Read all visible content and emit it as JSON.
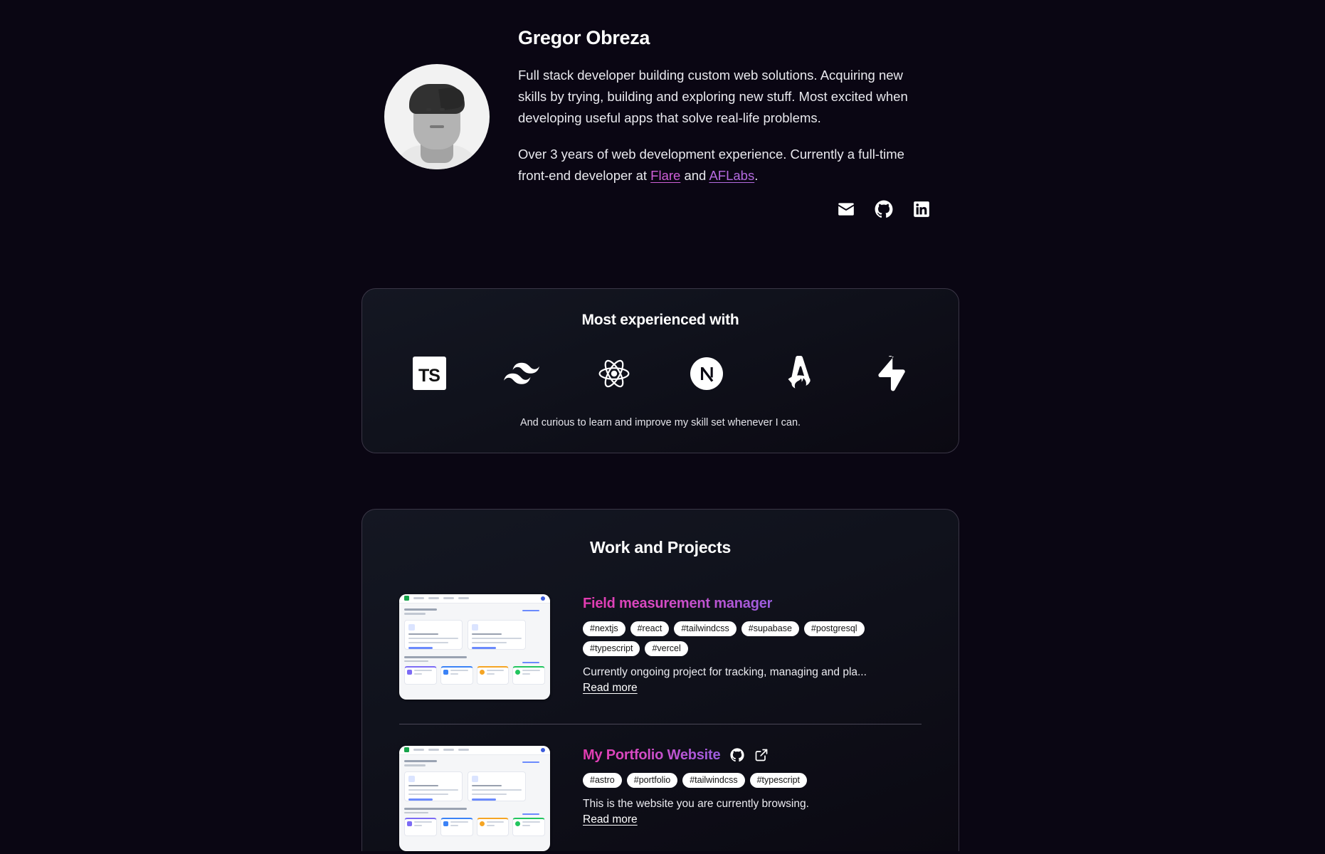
{
  "hero": {
    "name": "Gregor Obreza",
    "avatar_alt": "portrait-photo",
    "paragraph1": "Full stack developer building custom web solutions. Acquiring new skills by trying, building and exploring new stuff. Most excited when developing useful apps that solve real-life problems.",
    "paragraph2_before": "Over 3 years of web development experience. Currently a full-time front-end developer at ",
    "link_flare": "Flare",
    "paragraph2_middle": " and ",
    "link_aflabs": "AFLabs",
    "paragraph2_after": ".",
    "socials": [
      {
        "name": "email-icon",
        "label": "Email"
      },
      {
        "name": "github-icon",
        "label": "GitHub"
      },
      {
        "name": "linkedin-icon",
        "label": "LinkedIn"
      }
    ]
  },
  "skills": {
    "title": "Most experienced with",
    "note": "And curious to learn and improve my skill set whenever I can.",
    "items": [
      {
        "icon": "typescript-icon",
        "label": "TypeScript",
        "glyph": "TS"
      },
      {
        "icon": "tailwindcss-icon",
        "label": "Tailwind CSS"
      },
      {
        "icon": "react-icon",
        "label": "React"
      },
      {
        "icon": "nextjs-icon",
        "label": "Next.js"
      },
      {
        "icon": "astro-icon",
        "label": "Astro"
      },
      {
        "icon": "supabase-icon",
        "label": "Supabase"
      }
    ]
  },
  "projects": {
    "title": "Work and Projects",
    "read_more_label": "Read more",
    "items": [
      {
        "title": "Field measurement manager",
        "thumbnail": "dashboard-screenshot",
        "tags": [
          "#nextjs",
          "#react",
          "#tailwindcss",
          "#supabase",
          "#postgresql",
          "#typescript",
          "#vercel"
        ],
        "description": "Currently ongoing project for tracking, managing and pla...",
        "links": []
      },
      {
        "title": "My Portfolio Website",
        "thumbnail": "dashboard-screenshot",
        "tags": [
          "#astro",
          "#portfolio",
          "#tailwindcss",
          "#typescript"
        ],
        "description": "This is the website you are currently browsing.",
        "links": [
          {
            "name": "github-icon",
            "label": "GitHub repository"
          },
          {
            "name": "external-link-icon",
            "label": "Open live site"
          }
        ]
      }
    ]
  },
  "colors": {
    "background": "#0a0613",
    "card_border": "#3a3646",
    "accent_pink": "#e23bb0",
    "accent_purple": "#9b5ee0",
    "text_primary": "#ffffff",
    "text_secondary": "#e9e9ee",
    "tag_background": "#ffffff"
  }
}
